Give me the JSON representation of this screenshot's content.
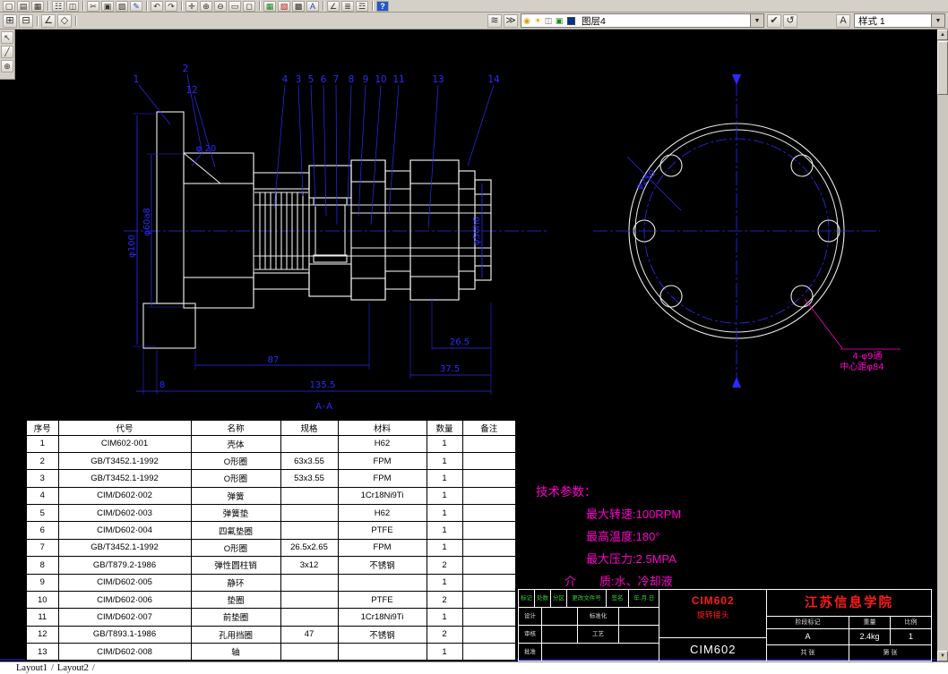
{
  "toolbar": {
    "row1": [
      {
        "n": "new",
        "g": "▢"
      },
      {
        "n": "open",
        "g": "▤"
      },
      {
        "n": "save",
        "g": "▦"
      },
      {
        "n": "sep"
      },
      {
        "n": "plot",
        "g": "☷"
      },
      {
        "n": "print-preview",
        "g": "◫"
      },
      {
        "n": "sep"
      },
      {
        "n": "cut",
        "g": "✂"
      },
      {
        "n": "copy",
        "g": "▣"
      },
      {
        "n": "paste",
        "g": "▨"
      },
      {
        "n": "match-properties",
        "g": "✎",
        "c": "blue"
      },
      {
        "n": "sep"
      },
      {
        "n": "undo",
        "g": "↶"
      },
      {
        "n": "redo",
        "g": "↷"
      },
      {
        "n": "sep"
      },
      {
        "n": "pan",
        "g": "✛"
      },
      {
        "n": "zoom-in",
        "g": "⊕"
      },
      {
        "n": "zoom-out",
        "g": "⊖"
      },
      {
        "n": "zoom-window",
        "g": "▭"
      },
      {
        "n": "zoom-extents",
        "g": "◻"
      },
      {
        "n": "sep"
      },
      {
        "n": "insert-table",
        "g": "▦",
        "c": "green"
      },
      {
        "n": "insert-block",
        "g": "▧",
        "c": "red"
      },
      {
        "n": "hatch",
        "g": "▩"
      },
      {
        "n": "text",
        "g": "A",
        "c": "blue"
      },
      {
        "n": "sep"
      },
      {
        "n": "measure",
        "g": "∠"
      },
      {
        "n": "layer-list",
        "g": "≣"
      },
      {
        "n": "properties",
        "g": "☲"
      },
      {
        "n": "sep"
      },
      {
        "n": "help",
        "g": "?",
        "c": "help"
      }
    ],
    "row2_left": [
      {
        "n": "qnew",
        "g": "⊞"
      },
      {
        "n": "osnap-settings",
        "g": "⊟"
      },
      {
        "n": "sep"
      },
      {
        "n": "ucs",
        "g": "∠"
      },
      {
        "n": "named-views",
        "g": "◇"
      },
      {
        "n": "sep"
      }
    ],
    "layer_tools": [
      {
        "n": "layer-properties-manager",
        "g": "≋"
      },
      {
        "n": "layer-states",
        "g": "≫"
      }
    ],
    "layer_combo_icons": [
      {
        "n": "layer-on",
        "g": "◉",
        "c": "yellow"
      },
      {
        "n": "layer-freeze",
        "g": "☀",
        "c": "yellow"
      },
      {
        "n": "layer-lock",
        "g": "◫",
        "c": "gray"
      },
      {
        "n": "layer-plot",
        "g": "▣",
        "c": "green"
      }
    ],
    "layer_value": "图层4",
    "layer_swatch": "#003399",
    "post_layer_tools": [
      {
        "n": "make-object-layer-current",
        "g": "✔"
      },
      {
        "n": "layer-previous",
        "g": "↺"
      }
    ],
    "text_style_glyph": "A",
    "style_value": "样式 1",
    "dropdown_glyph": "▼",
    "left_tools": [
      {
        "n": "select",
        "g": "↖"
      },
      {
        "n": "draw-line",
        "g": "╱"
      },
      {
        "n": "zoom-tool",
        "g": "⊕"
      }
    ]
  },
  "scrollbar": {
    "up": "▲",
    "down": "▼"
  },
  "tabs": [
    "Layout1",
    "Layout2"
  ],
  "drawing": {
    "balloons": [
      "1",
      "2",
      "12",
      "4",
      "3",
      "5",
      "6",
      "7",
      "8",
      "9",
      "10",
      "11",
      "13",
      "14"
    ],
    "dims": {
      "len8": "8",
      "len87": "87",
      "len135": "135.5",
      "len37": "37.5",
      "len26": "26.5",
      "dia100": "φ100",
      "dia60": "φ60a8",
      "dia20": "φ 20",
      "dia50": "φ50h6",
      "section": "A-A"
    },
    "circle": {
      "dia250": "φ250",
      "note1": "4-φ9通",
      "note2": "中心距φ84"
    }
  },
  "tech_params": {
    "title": "技术参数：",
    "line1": "最大转速:100RPM",
    "line2": "最高温度:180°",
    "line3": "最大压力:2.5MPA",
    "line4": "介　　质:水、冷却液"
  },
  "bom": {
    "headers": [
      "序号",
      "代号",
      "名称",
      "规格",
      "材料",
      "数量",
      "备注"
    ],
    "rows": [
      [
        "1",
        "CIM602·001",
        "壳体",
        "",
        "H62",
        "1",
        ""
      ],
      [
        "2",
        "GB/T3452.1-1992",
        "O形圈",
        "63x3.55",
        "FPM",
        "1",
        ""
      ],
      [
        "3",
        "GB/T3452.1-1992",
        "O形圈",
        "53x3.55",
        "FPM",
        "1",
        ""
      ],
      [
        "4",
        "CIM/D602·002",
        "弹簧",
        "",
        "1Cr18Ni9Ti",
        "1",
        ""
      ],
      [
        "5",
        "CIM/D602·003",
        "弹簧垫",
        "",
        "H62",
        "1",
        ""
      ],
      [
        "6",
        "CIM/D602·004",
        "四氟垫圈",
        "",
        "PTFE",
        "1",
        ""
      ],
      [
        "7",
        "GB/T3452.1-1992",
        "O形圈",
        "26.5x2.65",
        "FPM",
        "1",
        ""
      ],
      [
        "8",
        "GB/T879.2-1986",
        "弹性圆柱销",
        "3x12",
        "不锈钢",
        "2",
        ""
      ],
      [
        "9",
        "CIM/D602·005",
        "静环",
        "",
        "",
        "1",
        ""
      ],
      [
        "10",
        "CIM/D602·006",
        "垫圈",
        "",
        "PTFE",
        "2",
        ""
      ],
      [
        "11",
        "CIM/D602·007",
        "前垫圈",
        "",
        "1Cr18Ni9Ti",
        "1",
        ""
      ],
      [
        "12",
        "GB/T893.1-1986",
        "孔用挡圈",
        "47",
        "不锈钢",
        "2",
        ""
      ],
      [
        "13",
        "CIM/D602·008",
        "轴",
        "",
        "",
        "1",
        ""
      ]
    ]
  },
  "title_block": {
    "company": "江苏信息学院",
    "drawing_code": "CIM602",
    "drawing_name": "旋转接头",
    "bottom_code": "CIM602",
    "stage_label": "阶段标记",
    "weight_label": "重量",
    "scale_label": "比例",
    "stage_value": "A",
    "weight_value": "2.4kg",
    "scale_value": "1",
    "sheets": "共 张",
    "sheet_no": "第 张",
    "row_labels": [
      "标记",
      "处数",
      "分区",
      "更改文件号",
      "签名",
      "年.月.日"
    ],
    "roles": [
      "设计",
      "审核",
      "工艺",
      "批准",
      "标准化"
    ]
  }
}
